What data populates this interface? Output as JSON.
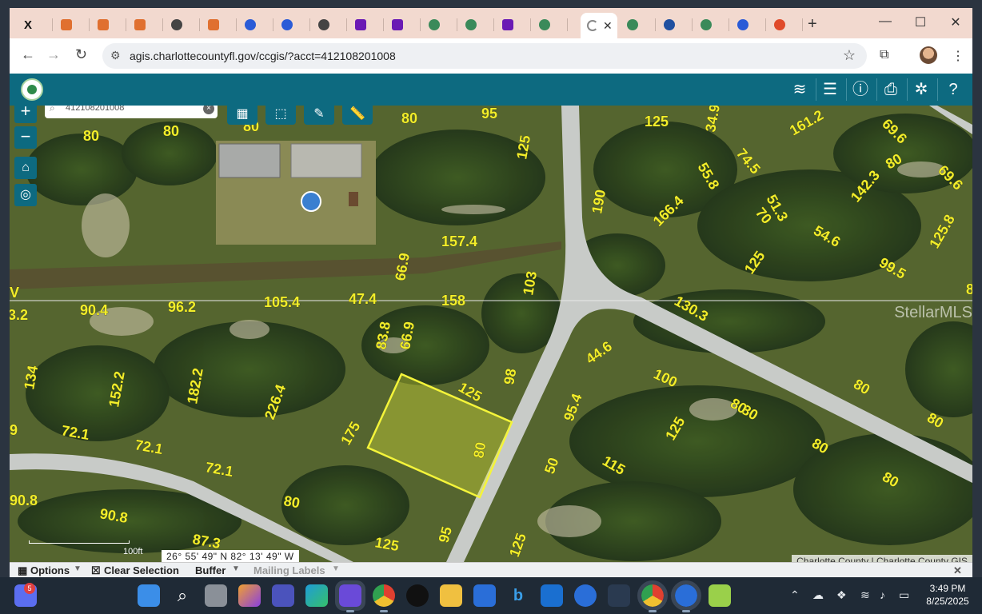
{
  "browser": {
    "tabs": [
      {
        "icon": "x-icon",
        "color": "#111111",
        "letter": "X"
      },
      {
        "icon": "orange-cube-icon",
        "color": "#e07030"
      },
      {
        "icon": "orange-cube-icon",
        "color": "#e07030"
      },
      {
        "icon": "orange-cube-icon",
        "color": "#e07030"
      },
      {
        "icon": "globe-icon",
        "color": "#444444"
      },
      {
        "icon": "orange-cube-icon",
        "color": "#e07030"
      },
      {
        "icon": "gear-icon",
        "color": "#2a5bd7"
      },
      {
        "icon": "gear-icon",
        "color": "#2a5bd7"
      },
      {
        "icon": "globe-icon",
        "color": "#444444"
      },
      {
        "icon": "yahoo-icon",
        "color": "#6a1ab4"
      },
      {
        "icon": "yahoo-icon",
        "color": "#6a1ab4"
      },
      {
        "icon": "county-seal-icon",
        "color": "#3a8a5a"
      },
      {
        "icon": "county-seal-icon",
        "color": "#3a8a5a"
      },
      {
        "icon": "yahoo-icon",
        "color": "#6a1ab4"
      },
      {
        "icon": "county-seal-icon",
        "color": "#3a8a5a"
      },
      {
        "icon": "county-seal-icon",
        "color": "#3a8a5a",
        "active": true
      },
      {
        "icon": "county-seal-icon",
        "color": "#3a8a5a"
      },
      {
        "icon": "blue-badge-icon",
        "color": "#2050a0"
      },
      {
        "icon": "county-seal-icon",
        "color": "#3a8a5a"
      },
      {
        "icon": "gear-icon",
        "color": "#2a5bd7"
      },
      {
        "icon": "red-circle-icon",
        "color": "#e04a2a"
      }
    ],
    "url": "agis.charlottecountyfl.gov/ccgis/?acct=412108201008"
  },
  "search": {
    "value": "412108201008"
  },
  "map": {
    "coordinates": "26° 55' 49\" N 82° 13' 49\" W",
    "scale_label": "100ft",
    "attribution": "Charlotte County | Charlotte County GIS",
    "watermark": "StellarMLS",
    "parcel_labels": [
      {
        "text": "80"
      },
      {
        "text": "80"
      },
      {
        "text": "80"
      },
      {
        "text": "80"
      },
      {
        "text": "80"
      },
      {
        "text": "95"
      },
      {
        "text": "125"
      },
      {
        "text": "125"
      },
      {
        "text": "34.9"
      },
      {
        "text": "55.8"
      },
      {
        "text": "74.5"
      },
      {
        "text": "161.2"
      },
      {
        "text": "69.6"
      },
      {
        "text": "69.6"
      },
      {
        "text": "190"
      },
      {
        "text": "166.4"
      },
      {
        "text": "51.3"
      },
      {
        "text": "70"
      },
      {
        "text": "142.3"
      },
      {
        "text": "54.6"
      },
      {
        "text": "125.8"
      },
      {
        "text": "99.5"
      },
      {
        "text": "157.4"
      },
      {
        "text": "66.9"
      },
      {
        "text": "103"
      },
      {
        "text": "125"
      },
      {
        "text": "130.3"
      },
      {
        "text": "8"
      },
      {
        "text": "V"
      },
      {
        "text": "3.2"
      },
      {
        "text": "90.4"
      },
      {
        "text": "96.2"
      },
      {
        "text": "105.4"
      },
      {
        "text": "47.4"
      },
      {
        "text": "158"
      },
      {
        "text": "83.8"
      },
      {
        "text": "66.9"
      },
      {
        "text": "134"
      },
      {
        "text": "152.2"
      },
      {
        "text": "182.2"
      },
      {
        "text": "226.4"
      },
      {
        "text": "125"
      },
      {
        "text": "98"
      },
      {
        "text": "44.6"
      },
      {
        "text": "100"
      },
      {
        "text": "80"
      },
      {
        "text": "80"
      },
      {
        "text": "80"
      },
      {
        "text": "9"
      },
      {
        "text": "72.1"
      },
      {
        "text": "72.1"
      },
      {
        "text": "72.1"
      },
      {
        "text": "175"
      },
      {
        "text": "80"
      },
      {
        "text": "95.4"
      },
      {
        "text": "125"
      },
      {
        "text": "80"
      },
      {
        "text": "50"
      },
      {
        "text": "115"
      },
      {
        "text": "80"
      },
      {
        "text": "90.8"
      },
      {
        "text": "90.8"
      },
      {
        "text": "80"
      },
      {
        "text": "95"
      },
      {
        "text": "80"
      },
      {
        "text": "87.3"
      },
      {
        "text": "125"
      },
      {
        "text": "125"
      }
    ]
  },
  "bottombar": {
    "options": "Options",
    "clear_selection": "Clear Selection",
    "buffer": "Buffer",
    "mailing_labels": "Mailing Labels"
  },
  "taskbar": {
    "badge_count": "5",
    "time": "3:49 PM",
    "date": "8/25/2025"
  },
  "colors": {
    "app_header": "#0d6a80",
    "parcel_label": "#f2ee2a",
    "selected_parcel": "#e8f03a",
    "tab_strip": "#f2d9cf"
  }
}
